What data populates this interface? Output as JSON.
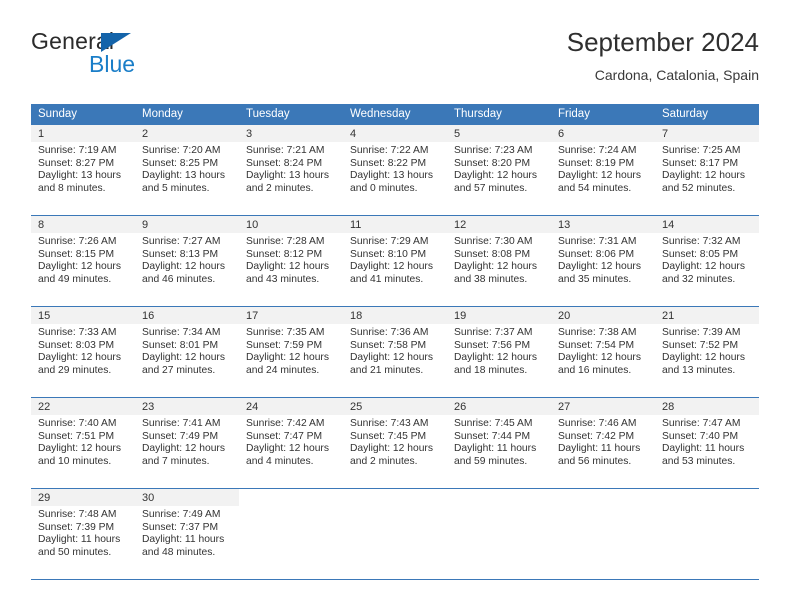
{
  "brand": {
    "name_part1": "General",
    "name_part2": "Blue",
    "triangle_color": "#1464aa",
    "blue_color": "#1a7ec8"
  },
  "header": {
    "title": "September 2024",
    "location": "Cardona, Catalonia, Spain"
  },
  "theme": {
    "header_bg": "#3b78b8",
    "daynum_bg": "#f2f2f2",
    "text": "#333333"
  },
  "weekday_headers": [
    "Sunday",
    "Monday",
    "Tuesday",
    "Wednesday",
    "Thursday",
    "Friday",
    "Saturday"
  ],
  "weeks": [
    [
      {
        "day": "1",
        "sunrise": "Sunrise: 7:19 AM",
        "sunset": "Sunset: 8:27 PM",
        "daylight1": "Daylight: 13 hours",
        "daylight2": "and 8 minutes."
      },
      {
        "day": "2",
        "sunrise": "Sunrise: 7:20 AM",
        "sunset": "Sunset: 8:25 PM",
        "daylight1": "Daylight: 13 hours",
        "daylight2": "and 5 minutes."
      },
      {
        "day": "3",
        "sunrise": "Sunrise: 7:21 AM",
        "sunset": "Sunset: 8:24 PM",
        "daylight1": "Daylight: 13 hours",
        "daylight2": "and 2 minutes."
      },
      {
        "day": "4",
        "sunrise": "Sunrise: 7:22 AM",
        "sunset": "Sunset: 8:22 PM",
        "daylight1": "Daylight: 13 hours",
        "daylight2": "and 0 minutes."
      },
      {
        "day": "5",
        "sunrise": "Sunrise: 7:23 AM",
        "sunset": "Sunset: 8:20 PM",
        "daylight1": "Daylight: 12 hours",
        "daylight2": "and 57 minutes."
      },
      {
        "day": "6",
        "sunrise": "Sunrise: 7:24 AM",
        "sunset": "Sunset: 8:19 PM",
        "daylight1": "Daylight: 12 hours",
        "daylight2": "and 54 minutes."
      },
      {
        "day": "7",
        "sunrise": "Sunrise: 7:25 AM",
        "sunset": "Sunset: 8:17 PM",
        "daylight1": "Daylight: 12 hours",
        "daylight2": "and 52 minutes."
      }
    ],
    [
      {
        "day": "8",
        "sunrise": "Sunrise: 7:26 AM",
        "sunset": "Sunset: 8:15 PM",
        "daylight1": "Daylight: 12 hours",
        "daylight2": "and 49 minutes."
      },
      {
        "day": "9",
        "sunrise": "Sunrise: 7:27 AM",
        "sunset": "Sunset: 8:13 PM",
        "daylight1": "Daylight: 12 hours",
        "daylight2": "and 46 minutes."
      },
      {
        "day": "10",
        "sunrise": "Sunrise: 7:28 AM",
        "sunset": "Sunset: 8:12 PM",
        "daylight1": "Daylight: 12 hours",
        "daylight2": "and 43 minutes."
      },
      {
        "day": "11",
        "sunrise": "Sunrise: 7:29 AM",
        "sunset": "Sunset: 8:10 PM",
        "daylight1": "Daylight: 12 hours",
        "daylight2": "and 41 minutes."
      },
      {
        "day": "12",
        "sunrise": "Sunrise: 7:30 AM",
        "sunset": "Sunset: 8:08 PM",
        "daylight1": "Daylight: 12 hours",
        "daylight2": "and 38 minutes."
      },
      {
        "day": "13",
        "sunrise": "Sunrise: 7:31 AM",
        "sunset": "Sunset: 8:06 PM",
        "daylight1": "Daylight: 12 hours",
        "daylight2": "and 35 minutes."
      },
      {
        "day": "14",
        "sunrise": "Sunrise: 7:32 AM",
        "sunset": "Sunset: 8:05 PM",
        "daylight1": "Daylight: 12 hours",
        "daylight2": "and 32 minutes."
      }
    ],
    [
      {
        "day": "15",
        "sunrise": "Sunrise: 7:33 AM",
        "sunset": "Sunset: 8:03 PM",
        "daylight1": "Daylight: 12 hours",
        "daylight2": "and 29 minutes."
      },
      {
        "day": "16",
        "sunrise": "Sunrise: 7:34 AM",
        "sunset": "Sunset: 8:01 PM",
        "daylight1": "Daylight: 12 hours",
        "daylight2": "and 27 minutes."
      },
      {
        "day": "17",
        "sunrise": "Sunrise: 7:35 AM",
        "sunset": "Sunset: 7:59 PM",
        "daylight1": "Daylight: 12 hours",
        "daylight2": "and 24 minutes."
      },
      {
        "day": "18",
        "sunrise": "Sunrise: 7:36 AM",
        "sunset": "Sunset: 7:58 PM",
        "daylight1": "Daylight: 12 hours",
        "daylight2": "and 21 minutes."
      },
      {
        "day": "19",
        "sunrise": "Sunrise: 7:37 AM",
        "sunset": "Sunset: 7:56 PM",
        "daylight1": "Daylight: 12 hours",
        "daylight2": "and 18 minutes."
      },
      {
        "day": "20",
        "sunrise": "Sunrise: 7:38 AM",
        "sunset": "Sunset: 7:54 PM",
        "daylight1": "Daylight: 12 hours",
        "daylight2": "and 16 minutes."
      },
      {
        "day": "21",
        "sunrise": "Sunrise: 7:39 AM",
        "sunset": "Sunset: 7:52 PM",
        "daylight1": "Daylight: 12 hours",
        "daylight2": "and 13 minutes."
      }
    ],
    [
      {
        "day": "22",
        "sunrise": "Sunrise: 7:40 AM",
        "sunset": "Sunset: 7:51 PM",
        "daylight1": "Daylight: 12 hours",
        "daylight2": "and 10 minutes."
      },
      {
        "day": "23",
        "sunrise": "Sunrise: 7:41 AM",
        "sunset": "Sunset: 7:49 PM",
        "daylight1": "Daylight: 12 hours",
        "daylight2": "and 7 minutes."
      },
      {
        "day": "24",
        "sunrise": "Sunrise: 7:42 AM",
        "sunset": "Sunset: 7:47 PM",
        "daylight1": "Daylight: 12 hours",
        "daylight2": "and 4 minutes."
      },
      {
        "day": "25",
        "sunrise": "Sunrise: 7:43 AM",
        "sunset": "Sunset: 7:45 PM",
        "daylight1": "Daylight: 12 hours",
        "daylight2": "and 2 minutes."
      },
      {
        "day": "26",
        "sunrise": "Sunrise: 7:45 AM",
        "sunset": "Sunset: 7:44 PM",
        "daylight1": "Daylight: 11 hours",
        "daylight2": "and 59 minutes."
      },
      {
        "day": "27",
        "sunrise": "Sunrise: 7:46 AM",
        "sunset": "Sunset: 7:42 PM",
        "daylight1": "Daylight: 11 hours",
        "daylight2": "and 56 minutes."
      },
      {
        "day": "28",
        "sunrise": "Sunrise: 7:47 AM",
        "sunset": "Sunset: 7:40 PM",
        "daylight1": "Daylight: 11 hours",
        "daylight2": "and 53 minutes."
      }
    ],
    [
      {
        "day": "29",
        "sunrise": "Sunrise: 7:48 AM",
        "sunset": "Sunset: 7:39 PM",
        "daylight1": "Daylight: 11 hours",
        "daylight2": "and 50 minutes."
      },
      {
        "day": "30",
        "sunrise": "Sunrise: 7:49 AM",
        "sunset": "Sunset: 7:37 PM",
        "daylight1": "Daylight: 11 hours",
        "daylight2": "and 48 minutes."
      },
      {
        "day": "",
        "sunrise": "",
        "sunset": "",
        "daylight1": "",
        "daylight2": ""
      },
      {
        "day": "",
        "sunrise": "",
        "sunset": "",
        "daylight1": "",
        "daylight2": ""
      },
      {
        "day": "",
        "sunrise": "",
        "sunset": "",
        "daylight1": "",
        "daylight2": ""
      },
      {
        "day": "",
        "sunrise": "",
        "sunset": "",
        "daylight1": "",
        "daylight2": ""
      },
      {
        "day": "",
        "sunrise": "",
        "sunset": "",
        "daylight1": "",
        "daylight2": ""
      }
    ]
  ]
}
